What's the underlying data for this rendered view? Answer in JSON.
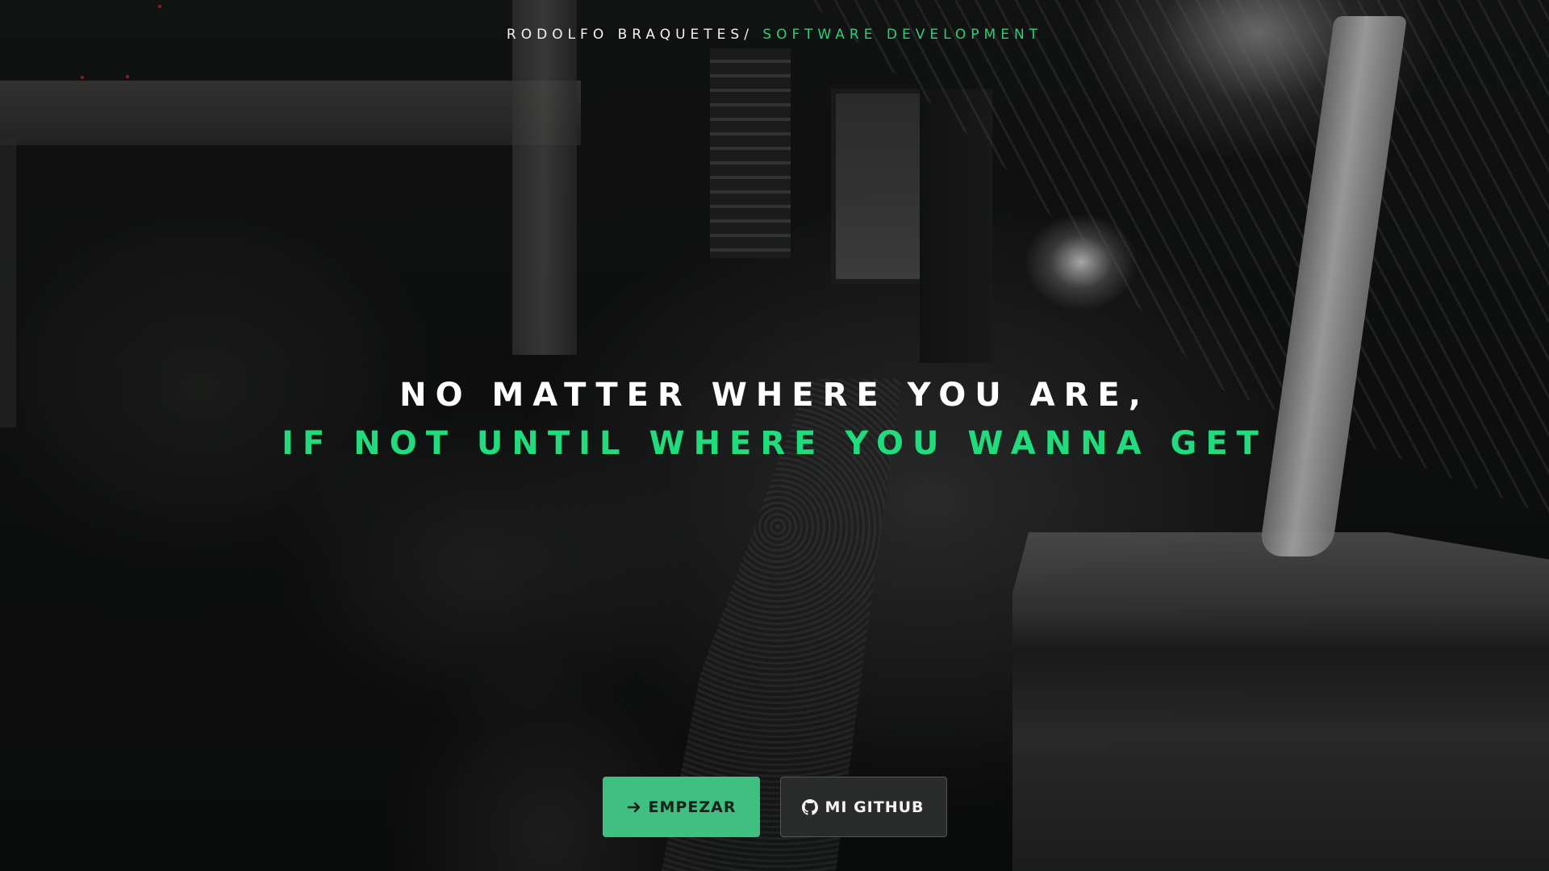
{
  "header": {
    "brand_name": "RODOLFO BRAQUETES/",
    "brand_tagline": "SOFTWARE DEVELOPMENT"
  },
  "hero": {
    "headline_line1": "NO MATTER WHERE YOU ARE,",
    "headline_line2": "IF NOT UNTIL WHERE YOU WANNA GET"
  },
  "actions": {
    "start_label": "EMPEZAR",
    "start_icon": "arrow-right-icon",
    "github_label": "MI GITHUB",
    "github_icon": "github-icon"
  },
  "colors": {
    "accent": "#1fdc7c",
    "primary_button": "#3fbf80",
    "secondary_button": "#2a2b2b"
  }
}
